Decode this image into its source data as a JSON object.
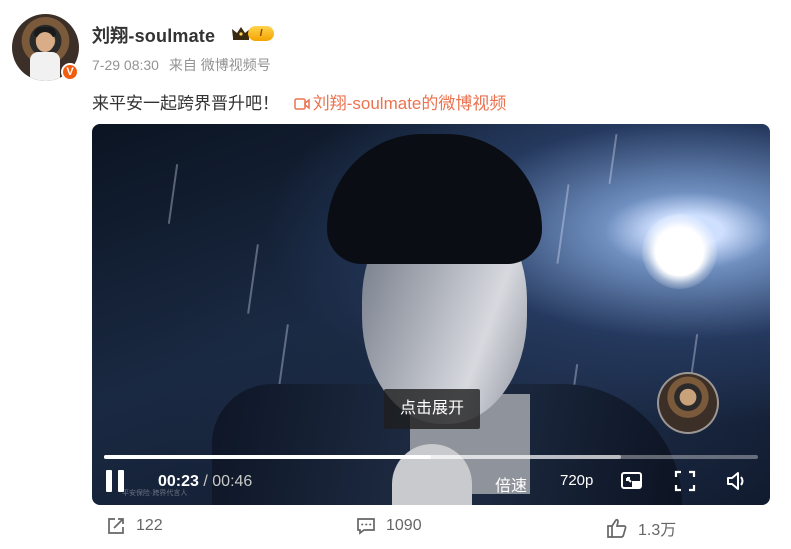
{
  "post": {
    "author": {
      "name": "刘翔-soulmate",
      "verified_badge": "V",
      "level_badge": "I",
      "avatar_icon": "avatar-icon",
      "crown_icon": "crown-icon"
    },
    "meta": {
      "date": "7-29 08:30",
      "source": "来自 微博视频号"
    },
    "text": "来平安一起跨界晋升吧！",
    "video_link": "刘翔-soulmate的微博视频"
  },
  "player": {
    "center_tooltip": "点击展开",
    "watermark": "平安保险·跨界代言人",
    "current_time": "00:23",
    "time_separator": "/",
    "duration": "00:46",
    "progress_fraction": 0.5,
    "buffered_fraction": 0.79,
    "speed_label": "倍速",
    "quality_label": "720p",
    "icons": [
      "pause-icon",
      "pip-icon",
      "fullscreen-icon",
      "volume-icon"
    ]
  },
  "actions": {
    "repost_count": "122",
    "comment_count": "1090",
    "like_count": "1.3万"
  },
  "colors": {
    "link_accent": "#eb7350",
    "verified_orange": "#f25c0f",
    "level_gold": "#f5a300"
  }
}
